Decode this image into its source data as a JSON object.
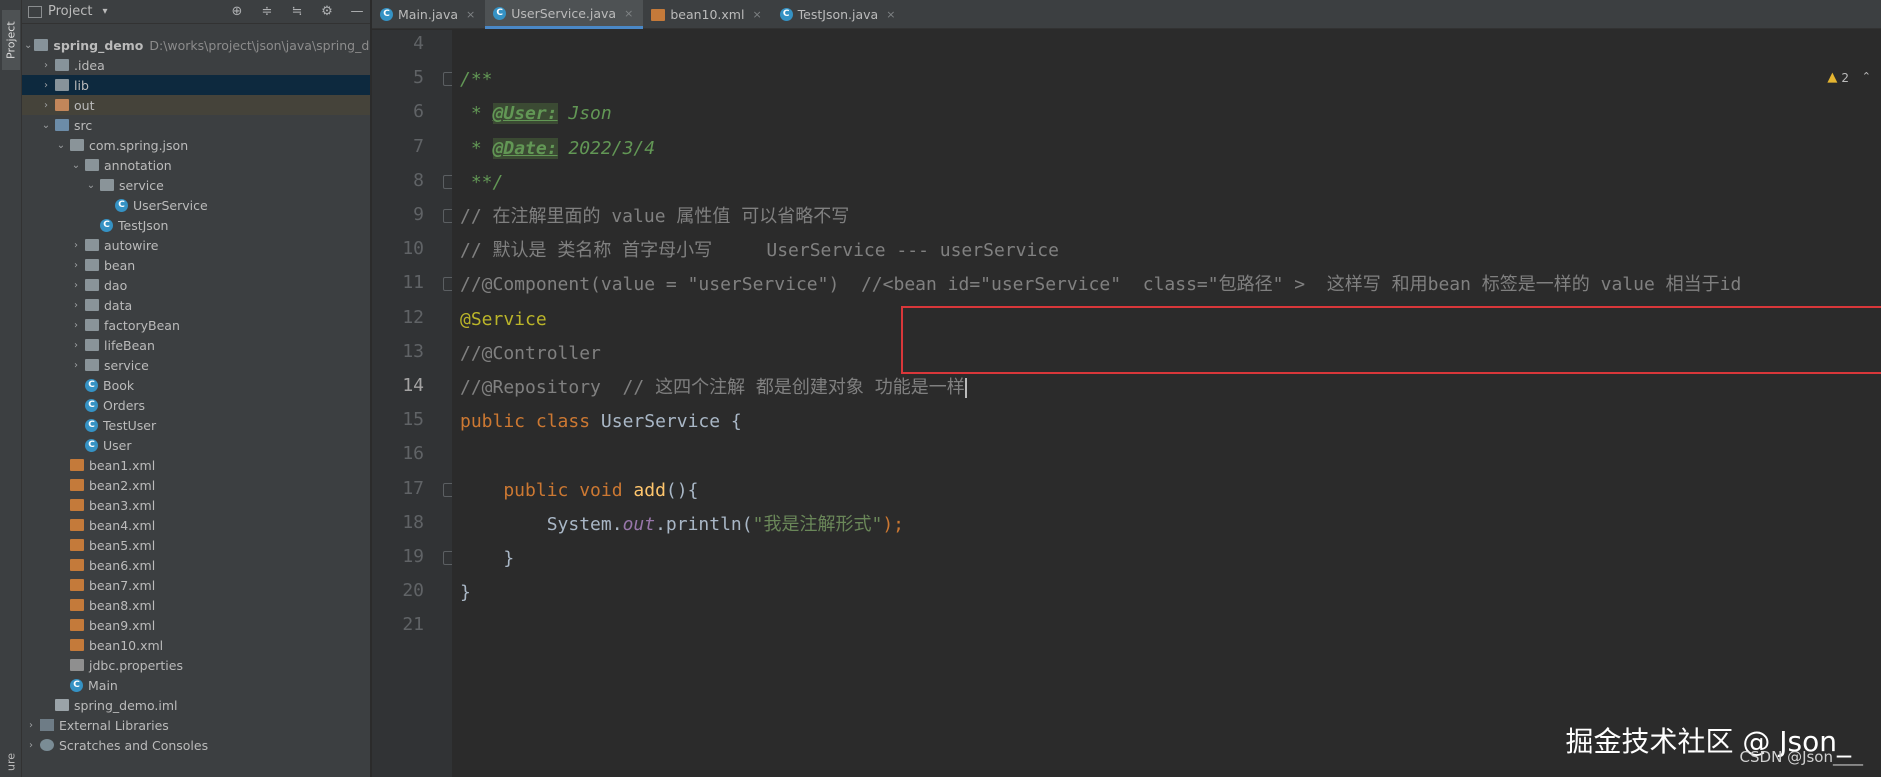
{
  "tool_stripe": {
    "project_tab": "Project",
    "bottom_tab": "ure"
  },
  "project_panel": {
    "title": "Project",
    "caret": "▾",
    "tools": [
      "⊕",
      "≑",
      "≒",
      "⚙",
      "—"
    ],
    "tree": [
      {
        "label": "spring_demo",
        "extra": "D:\\works\\project\\json\\java\\spring_der",
        "icon": "folder",
        "depth": 0,
        "arrow": "down",
        "bold": true
      },
      {
        "label": ".idea",
        "icon": "folder",
        "depth": 1,
        "arrow": "right"
      },
      {
        "label": "lib",
        "icon": "folder",
        "depth": 1,
        "arrow": "right",
        "selected": true
      },
      {
        "label": "out",
        "icon": "folder-orange",
        "depth": 1,
        "arrow": "right",
        "out": true
      },
      {
        "label": "src",
        "icon": "folder-blue",
        "depth": 1,
        "arrow": "down"
      },
      {
        "label": "com.spring.json",
        "icon": "pkg",
        "depth": 2,
        "arrow": "down"
      },
      {
        "label": "annotation",
        "icon": "pkg",
        "depth": 3,
        "arrow": "down"
      },
      {
        "label": "service",
        "icon": "pkg",
        "depth": 4,
        "arrow": "down"
      },
      {
        "label": "UserService",
        "icon": "cls",
        "depth": 5,
        "arrow": "none"
      },
      {
        "label": "TestJson",
        "icon": "cls",
        "depth": 4,
        "arrow": "none"
      },
      {
        "label": "autowire",
        "icon": "pkg",
        "depth": 3,
        "arrow": "right"
      },
      {
        "label": "bean",
        "icon": "pkg",
        "depth": 3,
        "arrow": "right"
      },
      {
        "label": "dao",
        "icon": "pkg",
        "depth": 3,
        "arrow": "right"
      },
      {
        "label": "data",
        "icon": "pkg",
        "depth": 3,
        "arrow": "right"
      },
      {
        "label": "factoryBean",
        "icon": "pkg",
        "depth": 3,
        "arrow": "right"
      },
      {
        "label": "lifeBean",
        "icon": "pkg",
        "depth": 3,
        "arrow": "right"
      },
      {
        "label": "service",
        "icon": "pkg",
        "depth": 3,
        "arrow": "right"
      },
      {
        "label": "Book",
        "icon": "cls",
        "depth": 3,
        "arrow": "none"
      },
      {
        "label": "Orders",
        "icon": "cls",
        "depth": 3,
        "arrow": "none"
      },
      {
        "label": "TestUser",
        "icon": "cls",
        "depth": 3,
        "arrow": "none"
      },
      {
        "label": "User",
        "icon": "cls",
        "depth": 3,
        "arrow": "none"
      },
      {
        "label": "bean1.xml",
        "icon": "xml",
        "depth": 2,
        "arrow": "none"
      },
      {
        "label": "bean2.xml",
        "icon": "xml",
        "depth": 2,
        "arrow": "none"
      },
      {
        "label": "bean3.xml",
        "icon": "xml",
        "depth": 2,
        "arrow": "none"
      },
      {
        "label": "bean4.xml",
        "icon": "xml",
        "depth": 2,
        "arrow": "none"
      },
      {
        "label": "bean5.xml",
        "icon": "xml",
        "depth": 2,
        "arrow": "none"
      },
      {
        "label": "bean6.xml",
        "icon": "xml",
        "depth": 2,
        "arrow": "none"
      },
      {
        "label": "bean7.xml",
        "icon": "xml",
        "depth": 2,
        "arrow": "none"
      },
      {
        "label": "bean8.xml",
        "icon": "xml",
        "depth": 2,
        "arrow": "none"
      },
      {
        "label": "bean9.xml",
        "icon": "xml",
        "depth": 2,
        "arrow": "none"
      },
      {
        "label": "bean10.xml",
        "icon": "xml",
        "depth": 2,
        "arrow": "none"
      },
      {
        "label": "jdbc.properties",
        "icon": "props",
        "depth": 2,
        "arrow": "none"
      },
      {
        "label": "Main",
        "icon": "cls",
        "depth": 2,
        "arrow": "none"
      },
      {
        "label": "spring_demo.iml",
        "icon": "iml",
        "depth": 1,
        "arrow": "none"
      },
      {
        "label": "External Libraries",
        "icon": "lib",
        "depth": 0,
        "arrow": "right"
      },
      {
        "label": "Scratches and Consoles",
        "icon": "scr",
        "depth": 0,
        "arrow": "right"
      }
    ]
  },
  "tabs": [
    {
      "label": "Main.java",
      "icon": "cls",
      "active": false
    },
    {
      "label": "UserService.java",
      "icon": "cls",
      "active": true
    },
    {
      "label": "bean10.xml",
      "icon": "xml",
      "active": false
    },
    {
      "label": "TestJson.java",
      "icon": "cls",
      "active": false
    }
  ],
  "tab_close": "×",
  "editor": {
    "warnings": "2",
    "warning_icon": "▲",
    "chevron": "⌃",
    "current_line": 14,
    "lines": [
      {
        "no": "4",
        "fold": false,
        "parts": []
      },
      {
        "no": "5",
        "fold": true,
        "parts": [
          {
            "t": "/**",
            "c": "c-doc"
          }
        ]
      },
      {
        "no": "6",
        "fold": false,
        "parts": [
          {
            "t": " * ",
            "c": "c-doc"
          },
          {
            "t": "@User:",
            "c": "c-tag"
          },
          {
            "t": " Json",
            "c": "c-doc"
          }
        ]
      },
      {
        "no": "7",
        "fold": false,
        "parts": [
          {
            "t": " * ",
            "c": "c-doc"
          },
          {
            "t": "@Date:",
            "c": "c-tag"
          },
          {
            "t": " 2022/3/4",
            "c": "c-doc"
          }
        ]
      },
      {
        "no": "8",
        "fold": true,
        "parts": [
          {
            "t": " **/",
            "c": "c-doc"
          }
        ]
      },
      {
        "no": "9",
        "fold": true,
        "parts": [
          {
            "t": "// 在注解里面的 value 属性值 可以省略不写",
            "c": "c-com"
          }
        ]
      },
      {
        "no": "10",
        "fold": false,
        "parts": [
          {
            "t": "// 默认是 类名称 首字母小写     UserService --- userService",
            "c": "c-com"
          }
        ]
      },
      {
        "no": "11",
        "fold": true,
        "parts": [
          {
            "t": "//@Component(value = \"userService\")  //<bean id=\"userService\"  class=\"包路径\" >  这样写 和用bean 标签是一样的 value 相当于id",
            "c": "c-com"
          }
        ]
      },
      {
        "no": "12",
        "fold": false,
        "parts": [
          {
            "t": "@Service",
            "c": "c-ann"
          }
        ]
      },
      {
        "no": "13",
        "fold": false,
        "parts": [
          {
            "t": "//@Controller",
            "c": "c-com"
          }
        ]
      },
      {
        "no": "14",
        "fold": false,
        "parts": [
          {
            "t": "//@Repository  // 这四个注解 都是创建对象 功能是一样",
            "c": "c-com"
          }
        ]
      },
      {
        "no": "15",
        "fold": false,
        "parts": [
          {
            "t": "public class ",
            "c": "c-kw"
          },
          {
            "t": "UserService {",
            "c": "c-plain"
          }
        ]
      },
      {
        "no": "16",
        "fold": false,
        "parts": []
      },
      {
        "no": "17",
        "fold": true,
        "parts": [
          {
            "t": "    public void ",
            "c": "c-kw"
          },
          {
            "t": "add",
            "c": "c-fn"
          },
          {
            "t": "(){",
            "c": "c-plain"
          }
        ]
      },
      {
        "no": "18",
        "fold": false,
        "parts": [
          {
            "t": "        System.",
            "c": "c-plain"
          },
          {
            "t": "out",
            "c": "c-field"
          },
          {
            "t": ".println(",
            "c": "c-plain"
          },
          {
            "t": "\"我是注解形式\"",
            "c": "c-str"
          },
          {
            "t": ");",
            "c": "c-kw"
          }
        ]
      },
      {
        "no": "19",
        "fold": true,
        "parts": [
          {
            "t": "    }",
            "c": "c-plain"
          }
        ]
      },
      {
        "no": "20",
        "fold": false,
        "parts": [
          {
            "t": "}",
            "c": "c-plain"
          }
        ]
      },
      {
        "no": "21",
        "fold": false,
        "parts": []
      }
    ]
  },
  "watermark": {
    "main": "掘金技术社区 @ Json_",
    "sub": "CSDN @Json____"
  }
}
